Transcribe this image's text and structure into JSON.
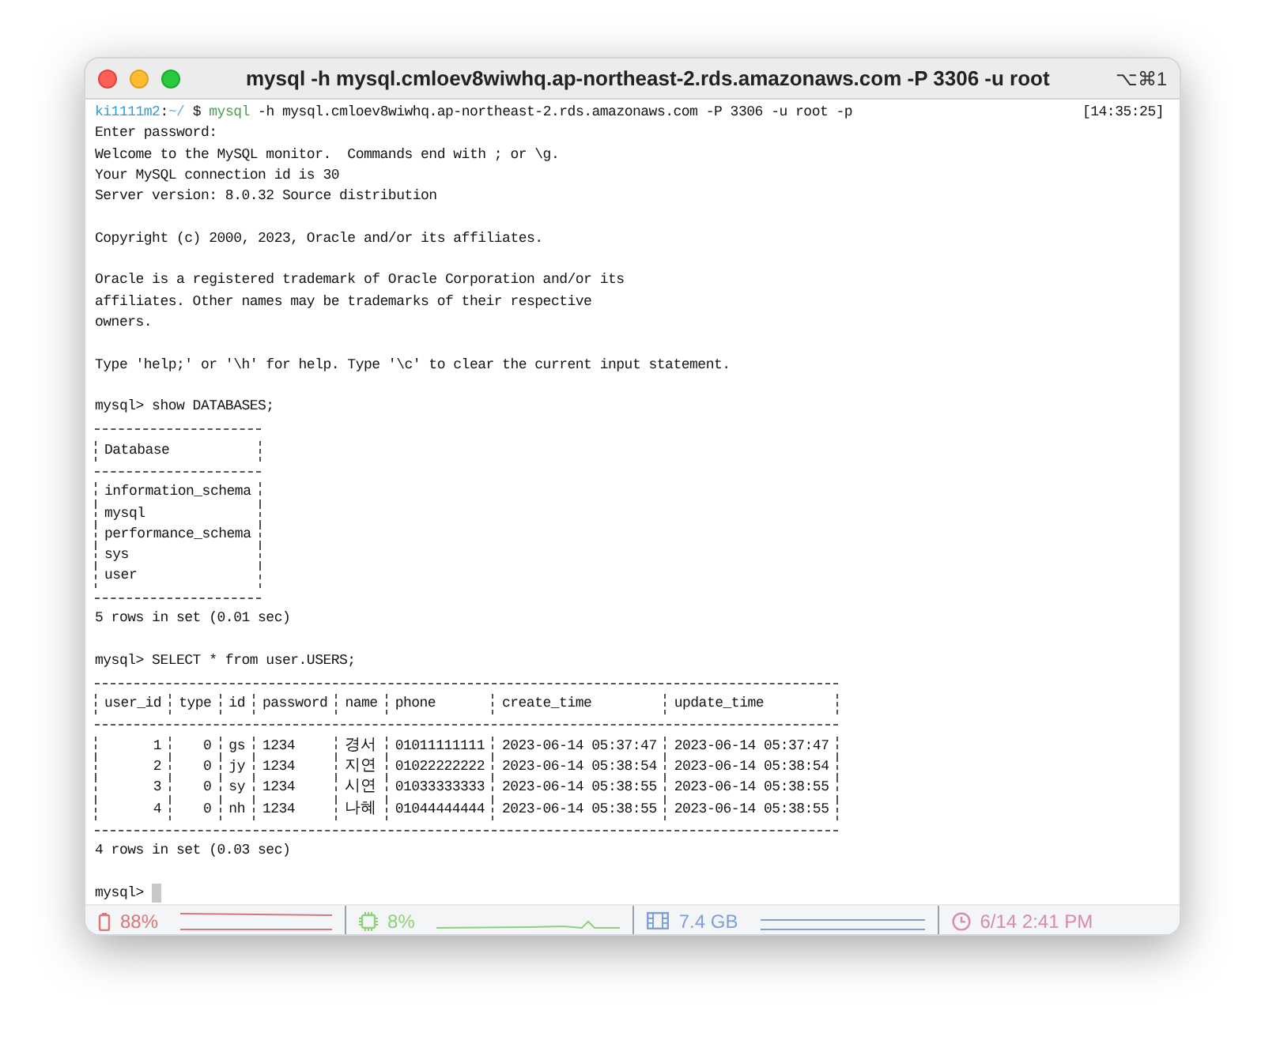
{
  "window": {
    "title": "mysql -h mysql.cmloev8wiwhq.ap-northeast-2.rds.amazonaws.com -P 3306 -u root",
    "shortcut": "⌥⌘1"
  },
  "prompt": {
    "user": "ki1111m2",
    "separator": ":",
    "path": "~/",
    "symbol": "$",
    "command": "mysql",
    "args": "-h mysql.cmloev8wiwhq.ap-northeast-2.rds.amazonaws.com -P 3306 -u root -p",
    "time": "[14:35:25]"
  },
  "output": [
    {
      "kind": "text",
      "lines": [
        "Enter password:",
        "Welcome to the MySQL monitor.  Commands end with ; or \\g.",
        "Your MySQL connection id is 30",
        "Server version: 8.0.32 Source distribution"
      ]
    },
    {
      "kind": "gap"
    },
    {
      "kind": "text",
      "lines": [
        "Copyright (c) 2000, 2023, Oracle and/or its affiliates."
      ]
    },
    {
      "kind": "gap"
    },
    {
      "kind": "text",
      "lines": [
        "Oracle is a registered trademark of Oracle Corporation and/or its",
        "affiliates. Other names may be trademarks of their respective",
        "owners."
      ]
    },
    {
      "kind": "gap"
    },
    {
      "kind": "text",
      "lines": [
        "Type 'help;' or '\\h' for help. Type '\\c' to clear the current input statement."
      ]
    },
    {
      "kind": "gap"
    },
    {
      "kind": "text",
      "lines": [
        "mysql> show DATABASES;"
      ]
    },
    {
      "kind": "table",
      "columns": [
        {
          "label": "Database",
          "numeric": false
        }
      ],
      "rows": [
        [
          "information_schema"
        ],
        [
          "mysql"
        ],
        [
          "performance_schema"
        ],
        [
          "sys"
        ],
        [
          "user"
        ]
      ]
    },
    {
      "kind": "text",
      "lines": [
        "5 rows in set (0.01 sec)"
      ]
    },
    {
      "kind": "gap"
    },
    {
      "kind": "text",
      "lines": [
        "mysql> SELECT * from user.USERS;"
      ]
    },
    {
      "kind": "table",
      "columns": [
        {
          "label": "user_id",
          "numeric": true
        },
        {
          "label": "type",
          "numeric": true
        },
        {
          "label": "id"
        },
        {
          "label": "password",
          "numeric": false
        },
        {
          "label": "name",
          "numeric": false
        },
        {
          "label": "phone"
        },
        {
          "label": "create_time"
        },
        {
          "label": "update_time"
        }
      ],
      "rows": [
        [
          "1",
          "0",
          "gs",
          "1234",
          "경서",
          "01011111111",
          "2023-06-14 05:37:47",
          "2023-06-14 05:37:47"
        ],
        [
          "2",
          "0",
          "jy",
          "1234",
          "지연",
          "01022222222",
          "2023-06-14 05:38:54",
          "2023-06-14 05:38:54"
        ],
        [
          "3",
          "0",
          "sy",
          "1234",
          "시연",
          "01033333333",
          "2023-06-14 05:38:55",
          "2023-06-14 05:38:55"
        ],
        [
          "4",
          "0",
          "nh",
          "1234",
          "나혜",
          "01044444444",
          "2023-06-14 05:38:55",
          "2023-06-14 05:38:55"
        ]
      ]
    },
    {
      "kind": "text",
      "lines": [
        "4 rows in set (0.03 sec)"
      ]
    },
    {
      "kind": "gap"
    },
    {
      "kind": "input",
      "prompt": "mysql>",
      "cursor": true
    }
  ],
  "status_bar": [
    {
      "kind": "battery",
      "value": "88%",
      "color": "#d9787a"
    },
    {
      "kind": "cpu",
      "value": "8%",
      "color": "#8fd17a"
    },
    {
      "kind": "memory",
      "value": "7.4 GB",
      "color": "#7f9fd8"
    },
    {
      "kind": "clock",
      "value": "6/14 2:41 PM",
      "color": "#d98ab0"
    }
  ]
}
